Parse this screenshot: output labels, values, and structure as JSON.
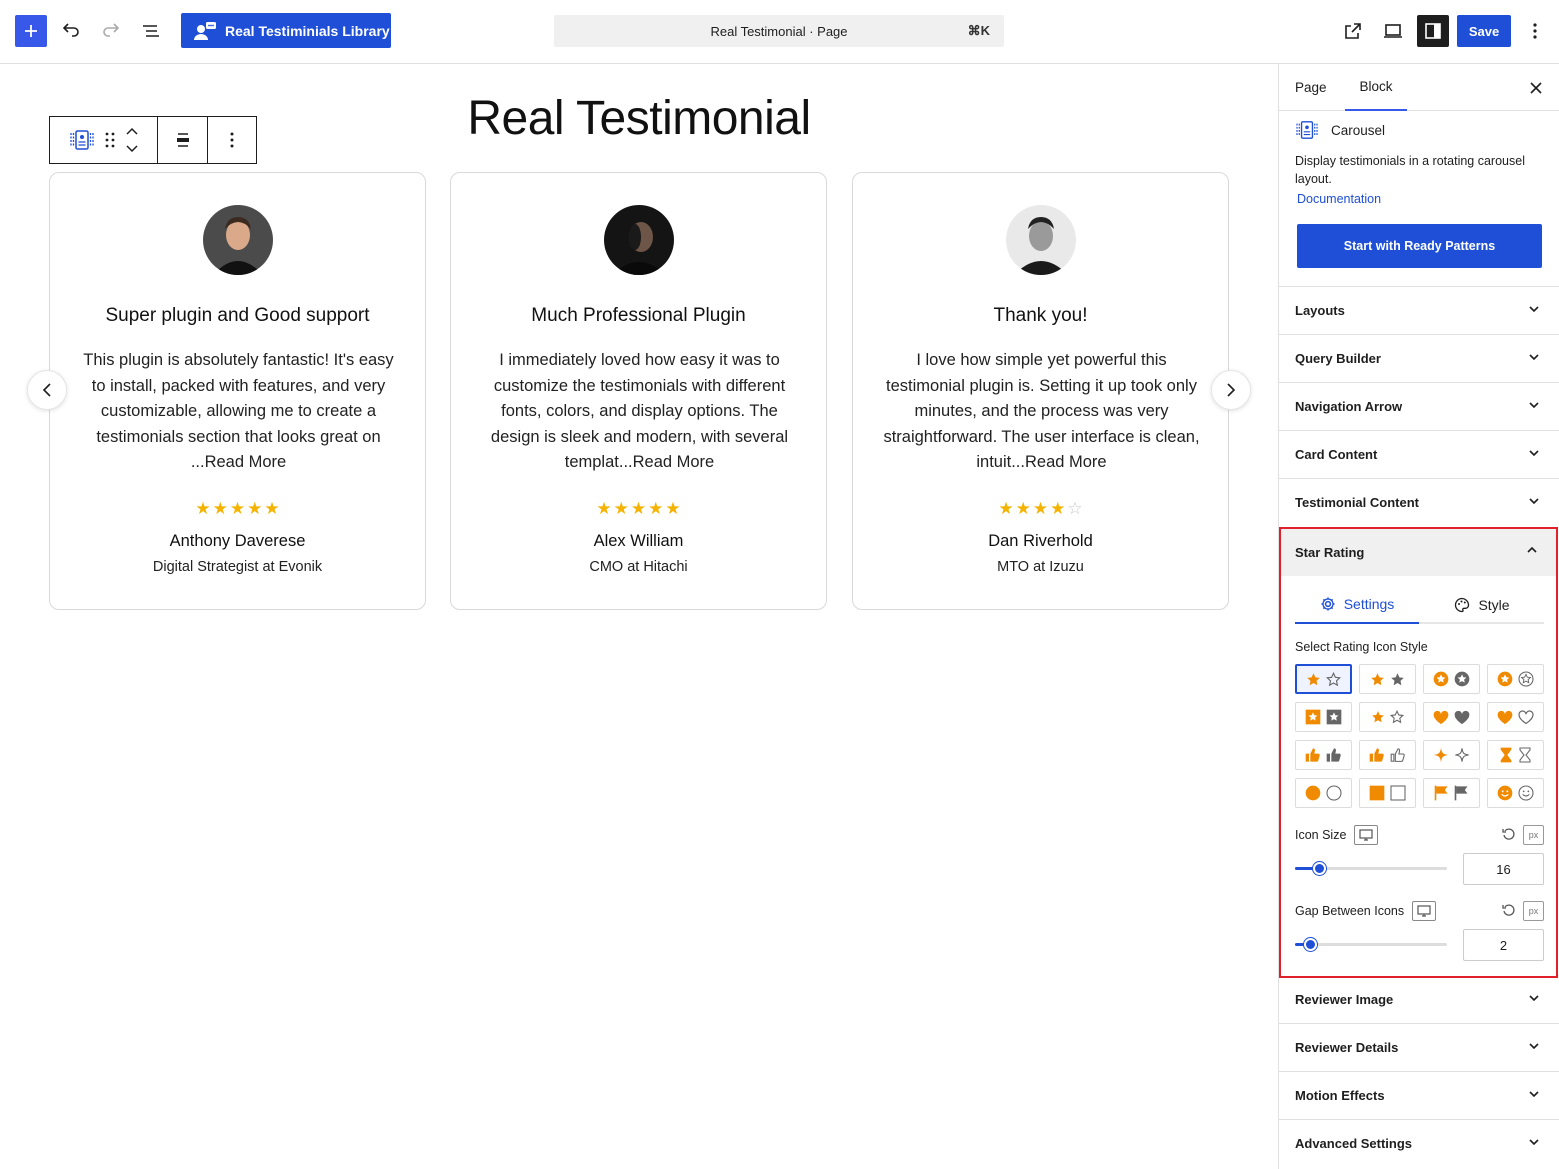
{
  "topbar": {
    "library_button_label": "Real Testiminials Library",
    "command_bar_text": "Real Testimonial · Page",
    "command_shortcut": "⌘K",
    "save_label": "Save"
  },
  "canvas": {
    "page_title": "Real Testimonial",
    "cards": [
      {
        "title": "Super plugin and Good support",
        "text": "This plugin is absolutely fantastic! It's easy to install, packed with features, and very customizable, allowing me to create a testimonials section that looks great on ...Read More",
        "rating": 5,
        "reviewer": "Anthony Daverese",
        "role": "Digital Strategist at Evonik"
      },
      {
        "title": "Much Professional Plugin",
        "text": "I immediately loved how easy it was to customize the testimonials with different fonts, colors, and display options. The design is sleek and modern, with several templat...Read More",
        "rating": 5,
        "reviewer": "Alex William",
        "role": "CMO at Hitachi"
      },
      {
        "title": "Thank you!",
        "text": "I love how simple yet powerful this testimonial plugin is. Setting it up took only minutes, and the process was very straightforward. The user interface is clean, intuit...Read More",
        "rating": 4,
        "reviewer": "Dan Riverhold",
        "role": "MTO at Izuzu"
      }
    ],
    "star_color": "#f5b301",
    "star_empty_color": "#c8c8c8"
  },
  "sidebar": {
    "tab_page": "Page",
    "tab_block": "Block",
    "block_name": "Carousel",
    "block_description": "Display testimonials in a rotating carousel layout.",
    "documentation_link": "Documentation",
    "ready_patterns_button": "Start with Ready Patterns",
    "panels_top": [
      "Layouts",
      "Query Builder",
      "Navigation Arrow",
      "Card Content",
      "Testimonial Content"
    ],
    "star_rating": {
      "title": "Star Rating",
      "tab_settings": "Settings",
      "tab_style": "Style",
      "select_label": "Select Rating Icon Style",
      "icon_styles": [
        "star-solid-outline",
        "star-solid-solid",
        "star-circle",
        "star-circle-outline",
        "star-square",
        "star-small-outline",
        "heart-solid",
        "heart-outline",
        "thumbs-solid",
        "thumbs-outline",
        "sparkle",
        "hourglass",
        "circle",
        "square",
        "flag",
        "smiley"
      ],
      "selected_style": "star-solid-outline",
      "icon_size_label": "Icon Size",
      "icon_size_value": "16",
      "icon_size_fraction": 0.16,
      "gap_label": "Gap Between Icons",
      "gap_value": "2",
      "gap_fraction": 0.1,
      "unit": "px"
    },
    "panels_bottom": [
      "Reviewer Image",
      "Reviewer Details",
      "Motion Effects",
      "Advanced Settings"
    ]
  },
  "colors": {
    "accent": "#1e4fd6",
    "icon_orange": "#f08a00",
    "highlight_border": "#e0202a"
  }
}
